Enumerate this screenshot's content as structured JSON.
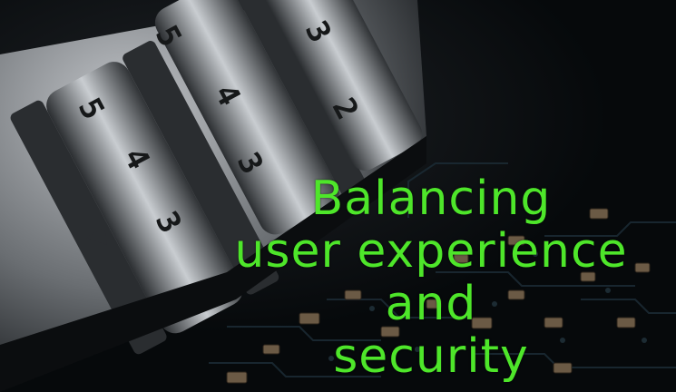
{
  "caption": {
    "lines": [
      "Balancing",
      "user experience",
      "and",
      "security"
    ]
  },
  "lock": {
    "dial_row_1": [
      "5",
      "4",
      "3"
    ],
    "dial_row_2": [
      "5",
      "4",
      "3"
    ],
    "dial_row_3": [
      "3",
      "2"
    ]
  },
  "colors": {
    "caption": "#4ee62a",
    "board": "#0a0e12",
    "metal": "#9a9ea3"
  }
}
